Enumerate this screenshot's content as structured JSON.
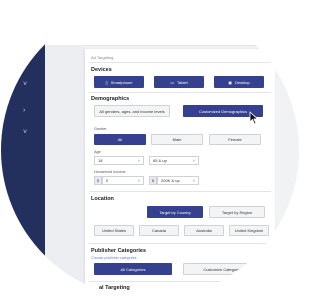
{
  "topbar": {
    "back_glyph": "‹"
  },
  "sidebar": {
    "chevrons": [
      "˅",
      "›",
      "˅"
    ]
  },
  "breadcrumb": "Ad Targeting",
  "devices": {
    "title": "Devices",
    "buttons": [
      {
        "label": "Smartphone",
        "icon": "phone-icon",
        "glyph": "▯"
      },
      {
        "label": "Tablet",
        "icon": "tablet-icon",
        "glyph": "▭"
      },
      {
        "label": "Desktop",
        "icon": "desktop-icon",
        "glyph": "▣"
      }
    ]
  },
  "demographics": {
    "title": "Demographics",
    "options": [
      "All genders, ages, and income levels",
      "Customized Demographics"
    ],
    "gender": {
      "label": "Gender",
      "options": [
        "All",
        "Male",
        "Female"
      ]
    },
    "age": {
      "label": "Age",
      "from": "18",
      "to": "65 & up"
    },
    "income": {
      "label": "Household Income",
      "prefix": "$",
      "from": "0",
      "to": "200K & up"
    }
  },
  "location": {
    "title": "Location",
    "options": [
      "Target by Country",
      "Target by Region"
    ],
    "countries": [
      "United States",
      "Canada",
      "Australia",
      "United Kingdom"
    ]
  },
  "publisher": {
    "title": "Publisher Categories",
    "link": "Choose publisher categories",
    "options": [
      "All Categories",
      "Customize Categories"
    ]
  },
  "next_section": {
    "title": "al Targeting"
  },
  "colors": {
    "primary": "#35418f",
    "sidebar": "#23305e",
    "link": "#6b7bd6"
  }
}
